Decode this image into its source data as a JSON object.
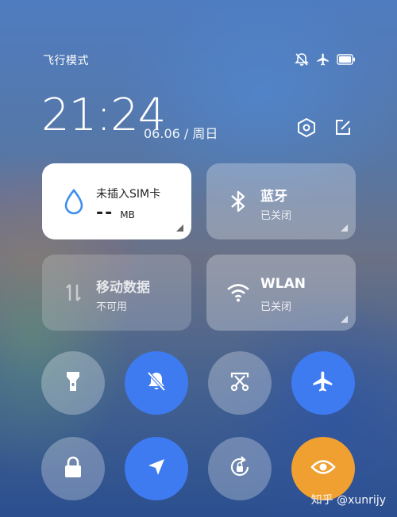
{
  "status": {
    "label": "飞行模式",
    "icons": [
      "mute-icon",
      "airplane-icon",
      "battery-icon"
    ]
  },
  "header": {
    "time": "21:24",
    "date": "06.06 / 周日",
    "settings_icon": "settings-icon",
    "edit_icon": "edit-icon"
  },
  "tiles": {
    "data": {
      "title": "未插入SIM卡",
      "value": "--",
      "unit": "MB",
      "icon": "water-drop-icon",
      "state": "on"
    },
    "bluetooth": {
      "title": "蓝牙",
      "status": "已关闭",
      "icon": "bluetooth-icon",
      "state": "off"
    },
    "mobile_data": {
      "title": "移动数据",
      "status": "不可用",
      "icon": "data-arrows-icon",
      "state": "disabled"
    },
    "wlan": {
      "title": "WLAN",
      "status": "已关闭",
      "icon": "wifi-icon",
      "state": "off"
    }
  },
  "toggles": [
    {
      "name": "flashlight",
      "icon": "flashlight-icon",
      "state": "off"
    },
    {
      "name": "mute",
      "icon": "bell-off-icon",
      "state": "on"
    },
    {
      "name": "screenshot",
      "icon": "scissors-icon",
      "state": "off"
    },
    {
      "name": "airplane",
      "icon": "airplane-icon",
      "state": "on"
    },
    {
      "name": "lock",
      "icon": "lock-icon",
      "state": "off"
    },
    {
      "name": "location",
      "icon": "location-arrow-icon",
      "state": "on"
    },
    {
      "name": "rotation-lock",
      "icon": "rotation-lock-icon",
      "state": "off"
    },
    {
      "name": "eye-comfort",
      "icon": "eye-icon",
      "state": "on"
    }
  ],
  "colors": {
    "accent_blue": "#3e7bf0",
    "accent_orange": "#f0a030"
  },
  "watermark": "知乎 @xunrijy"
}
